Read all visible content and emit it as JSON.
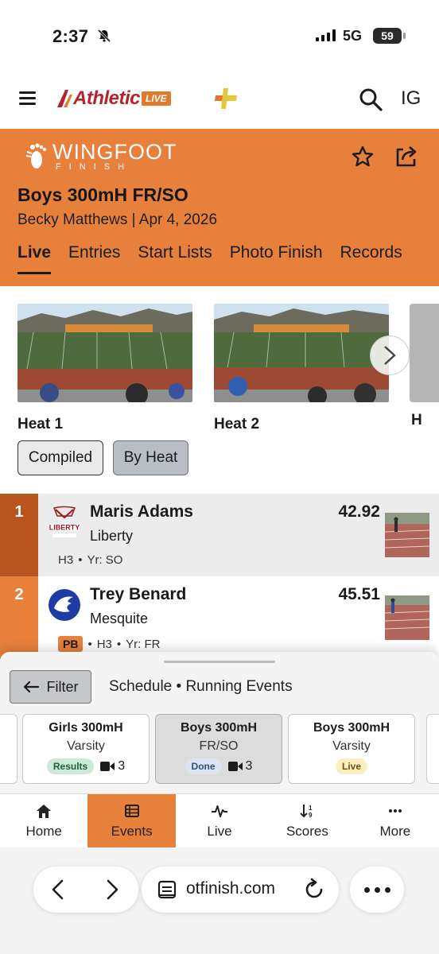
{
  "status_bar": {
    "time": "2:37",
    "network": "5G",
    "battery": "59"
  },
  "app_header": {
    "brand": "Athletic",
    "brand_badge": "LIVE",
    "account_initials": "IG"
  },
  "meet": {
    "org_name": "WINGFOOT",
    "org_sub": "FINISH",
    "title": "Boys 300mH FR/SO",
    "subtitle": "Becky Matthews | Apr 4, 2026",
    "tabs": [
      {
        "label": "Live",
        "active": true
      },
      {
        "label": "Entries"
      },
      {
        "label": "Start Lists"
      },
      {
        "label": "Photo Finish"
      },
      {
        "label": "Records"
      }
    ]
  },
  "heats": [
    {
      "label": "Heat 1"
    },
    {
      "label": "Heat 2"
    },
    {
      "label": "H"
    }
  ],
  "view_toggle": {
    "compiled": "Compiled",
    "by_heat": "By Heat",
    "selected": "By Heat"
  },
  "results": [
    {
      "place": "1",
      "name": "Maris Adams",
      "school": "Liberty",
      "mark": "42.92",
      "heat": "H3",
      "year": "Yr: SO",
      "pb": false
    },
    {
      "place": "2",
      "name": "Trey Benard",
      "school": "Mesquite",
      "mark": "45.51",
      "heat": "H3",
      "year": "Yr: FR",
      "pb": true,
      "pb_label": "PB"
    }
  ],
  "sheet": {
    "filter_label": "Filter",
    "breadcrumb": "Schedule • Running Events",
    "events": [
      {
        "name": "Girls 300mH",
        "division": "Varsity",
        "status": "Results",
        "videos": "3"
      },
      {
        "name": "Boys 300mH",
        "division": "FR/SO",
        "status": "Done",
        "videos": "3",
        "active": true
      },
      {
        "name": "Boys 300mH",
        "division": "Varsity",
        "status": "Live"
      }
    ]
  },
  "bottom_nav": [
    {
      "label": "Home",
      "icon": "home-icon"
    },
    {
      "label": "Events",
      "icon": "list-icon",
      "active": true
    },
    {
      "label": "Live",
      "icon": "pulse-icon"
    },
    {
      "label": "Scores",
      "icon": "sort-icon"
    },
    {
      "label": "More",
      "icon": "more-icon"
    }
  ],
  "browser": {
    "url": "otfinish.com"
  },
  "colors": {
    "accent": "#e6803a",
    "accent_dark": "#b8541e",
    "brand_red": "#b4232e"
  }
}
